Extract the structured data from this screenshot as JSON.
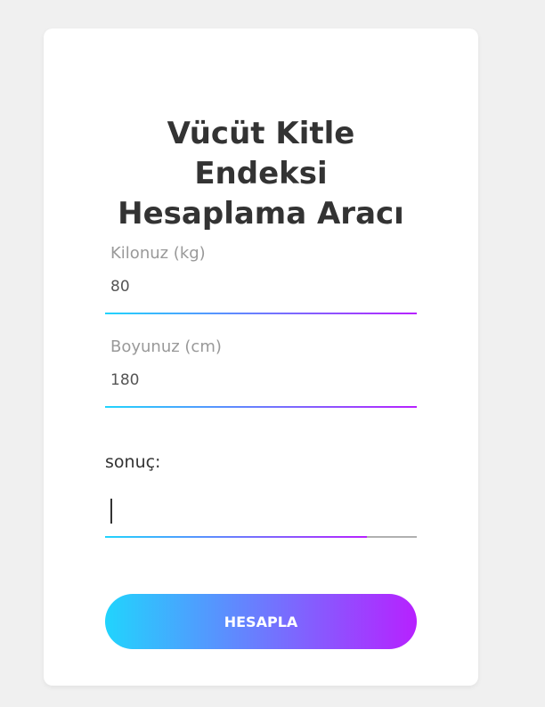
{
  "title": {
    "line1": "Vücüt Kitle",
    "line2": "Endeksi",
    "line3": "Hesaplama Aracı"
  },
  "weight": {
    "label": "Kilonuz (kg)",
    "value": "80"
  },
  "height": {
    "label": "Boyunuz (cm)",
    "value": "180"
  },
  "result": {
    "label": "sonuç:",
    "value": "",
    "focus_progress": 0.84
  },
  "button": {
    "label": "HESAPLA"
  },
  "colors": {
    "background": "#f0f0f0",
    "card": "#ffffff",
    "gradient_start": "#21d4fd",
    "gradient_end": "#b721ff",
    "title_text": "#333333",
    "label_text": "#999999"
  }
}
